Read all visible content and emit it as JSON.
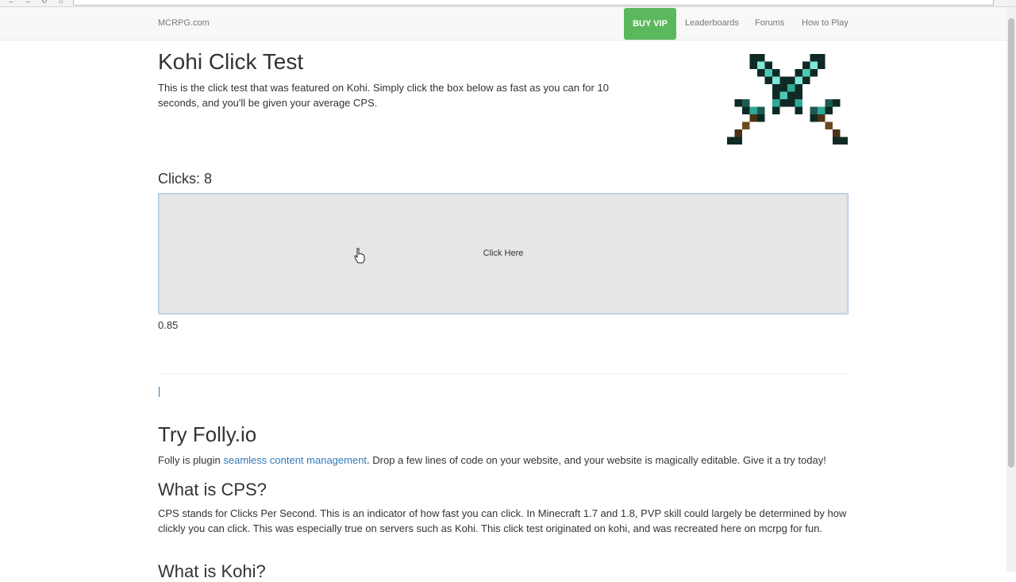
{
  "navbar": {
    "brand": "MCRPG.com",
    "vip_label": "BUY VIP",
    "links": [
      "Leaderboards",
      "Forums",
      "How to Play"
    ],
    "vip_color": "#5cb85c"
  },
  "hero": {
    "title": "Kohi Click Test",
    "intro": "This is the click test that was featured on Kohi. Simply click the box below as fast as you can for 10 seconds, and you'll be given your average CPS.",
    "logo_icon": "crossed-diamond-swords-icon"
  },
  "test": {
    "clicks_label": "Clicks: 8",
    "box_label": "Click Here",
    "cps_value": "0.85"
  },
  "folly": {
    "heading": "Try Folly.io",
    "text_before": "Folly is plugin ",
    "link_text": "seamless content management",
    "text_after": ". Drop a few lines of code on your website, and your website is magically editable. Give it a try today!"
  },
  "cps_section": {
    "heading": "What is CPS?",
    "text": "CPS stands for Clicks Per Second. This is an indicator of how fast you can click. In Minecraft 1.7 and 1.8, PVP skill could largely be determined by how clickly you can click. This was especially true on servers such as Kohi. This click test originated on kohi, and was recreated here on mcrpg for fun."
  },
  "kohi_section": {
    "heading": "What is Kohi?"
  },
  "colors": {
    "link": "#337ab7",
    "box_bg": "#e6e6e6",
    "box_border": "#a9c3e3"
  }
}
